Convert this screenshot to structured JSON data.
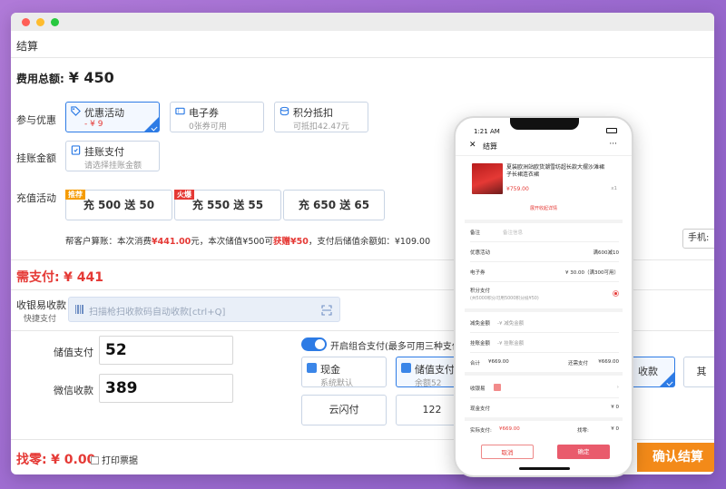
{
  "app": {
    "title": "结算"
  },
  "total": {
    "label": "费用总额:",
    "value": "¥ 450"
  },
  "discount": {
    "label": "参与优惠",
    "options": [
      {
        "title": "优惠活动",
        "sub": "- ¥ 9",
        "icon": "tag-icon"
      },
      {
        "title": "电子券",
        "sub": "0张券可用",
        "icon": "coupon-icon"
      },
      {
        "title": "积分抵扣",
        "sub": "可抵扣42.47元",
        "icon": "points-icon"
      }
    ]
  },
  "credit": {
    "label": "挂账金额",
    "title": "挂账支付",
    "sub": "请选择挂账金额"
  },
  "topup": {
    "label": "充值活动",
    "options": [
      {
        "text": "充 500 送 50",
        "tag": "推荐"
      },
      {
        "text": "充 550 送 55",
        "tag": "火爆"
      },
      {
        "text": "充 650 送 65",
        "tag": ""
      }
    ]
  },
  "calc_note": {
    "prefix": "帮客户算账：本次消费",
    "amount": "¥441.00",
    "mid": "元，本次储值¥500可",
    "gain": "获赠¥50",
    "suffix": "，支付后储值余额如：¥109.00"
  },
  "phone_field": {
    "label": "手机:"
  },
  "due": {
    "label": "需支付:",
    "value": "¥ 441"
  },
  "cashier": {
    "label": "收银易收款",
    "sub": "快捷支付",
    "placeholder": "扫描枪扫收款码自动收款[ctrl+Q]"
  },
  "payments": [
    {
      "label": "储值支付",
      "value": "52"
    },
    {
      "label": "微信收款",
      "value": "389"
    }
  ],
  "combo": {
    "label": "开启组合支付(最多可用三种支付"
  },
  "methods": [
    {
      "title": "现金",
      "sub": "系统默认"
    },
    {
      "title": "储值支付",
      "sub": "余额52"
    },
    {
      "title": "云闪付"
    },
    {
      "title": "122"
    },
    {
      "title": "收款"
    },
    {
      "title": "其"
    }
  ],
  "change": {
    "label": "找零:",
    "value": "¥ 0.00"
  },
  "print_label": "打印票据",
  "confirm_label": "确认结算",
  "phone": {
    "time": "1:21 AM",
    "title": "结算",
    "product": {
      "name": "夏装欧洲站欧货潮雪纺超长款大摆沙滩裙子长裙连衣裙",
      "price": "¥759.00",
      "qty": "x1"
    },
    "fold": "展开收起详情",
    "rows": [
      {
        "label": "备注",
        "value": "备注信息"
      },
      {
        "label": "优惠活动",
        "value": "满600减10"
      },
      {
        "label": "电子券",
        "value": "¥ 30.00（满300可用）"
      },
      {
        "label": "积分支付",
        "value": "(共5000积分可用5000积分抵¥50)"
      },
      {
        "label": "减免金额",
        "value": "-¥  减免金额"
      },
      {
        "label": "挂账金额",
        "value": "-¥  挂账金额"
      },
      {
        "label": "合计",
        "value": "¥669.00"
      },
      {
        "label": "还需支付",
        "value": "¥669.00"
      },
      {
        "label": "收银易",
        "value": ""
      },
      {
        "label": "现金支付",
        "value": "¥ 0"
      },
      {
        "label": "实际支付:",
        "value": "¥669.00"
      },
      {
        "label": "找零:",
        "value": "¥ 0"
      }
    ],
    "cancel": "取消",
    "ok": "确定"
  }
}
